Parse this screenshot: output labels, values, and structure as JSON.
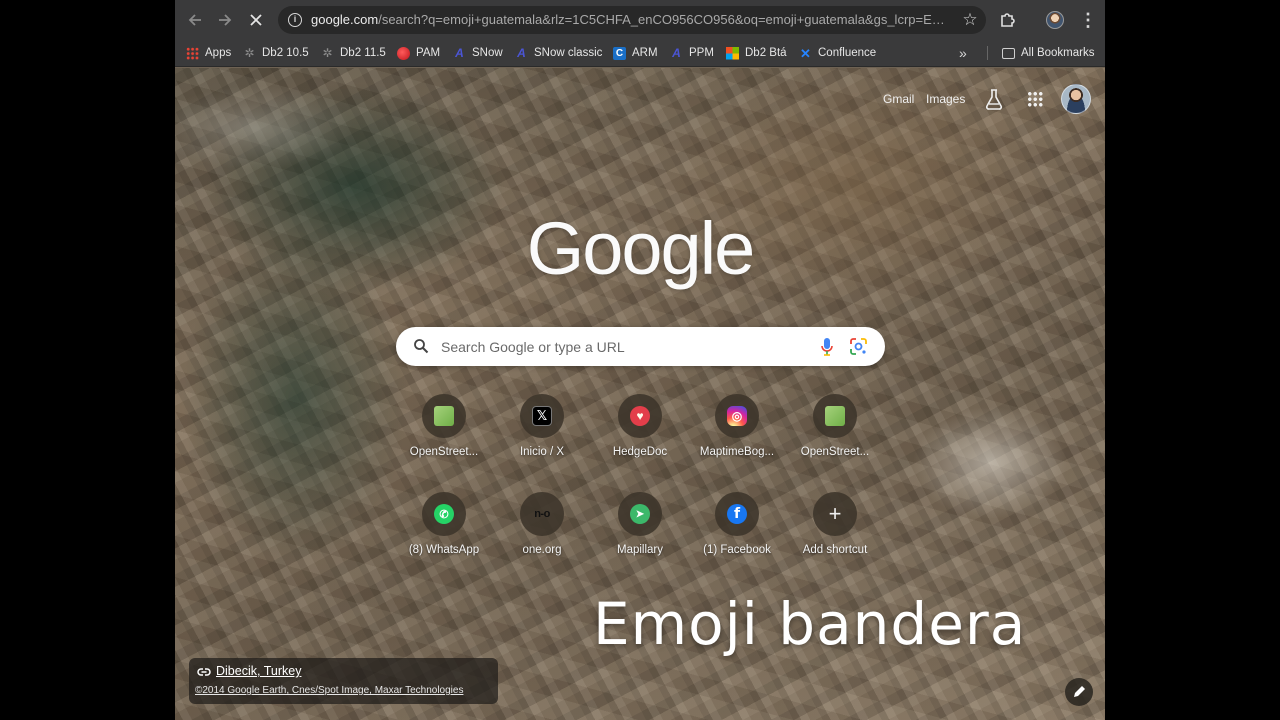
{
  "browser": {
    "url_host": "google.com",
    "url_rest": "/search?q=emoji+guatemala&rlz=1C5CHFA_enCO956CO956&oq=emoji+guatemala&gs_lcrp=EgZj...",
    "nav_icons": {
      "back": "arrow-left-icon",
      "forward": "arrow-right-icon",
      "stop": "close-icon"
    }
  },
  "bookmarks": {
    "items": [
      {
        "label": "Apps",
        "icon": "apps-grid-icon"
      },
      {
        "label": "Db2 10.5",
        "icon": "db2-icon"
      },
      {
        "label": "Db2 11.5",
        "icon": "db2-icon"
      },
      {
        "label": "PAM",
        "icon": "pam-icon"
      },
      {
        "label": "SNow",
        "icon": "servicenow-icon"
      },
      {
        "label": "SNow classic",
        "icon": "servicenow-icon"
      },
      {
        "label": "ARM",
        "icon": "arm-icon"
      },
      {
        "label": "PPM",
        "icon": "ppm-icon"
      },
      {
        "label": "Db2 Btá",
        "icon": "microsoft-icon"
      },
      {
        "label": "Confluence",
        "icon": "confluence-icon"
      }
    ],
    "all_bookmarks": "All Bookmarks"
  },
  "header": {
    "gmail": "Gmail",
    "images": "Images"
  },
  "logo": "Google",
  "search": {
    "placeholder": "Search Google or type a URL"
  },
  "shortcuts": [
    {
      "label": "OpenStreet...",
      "glyph": "",
      "icon": "openstreetmap-icon"
    },
    {
      "label": "Inicio / X",
      "glyph": "𝕏",
      "icon": "x-icon"
    },
    {
      "label": "HedgeDoc",
      "glyph": "♥",
      "icon": "hedgedoc-icon"
    },
    {
      "label": "MaptimeBog...",
      "glyph": "◎",
      "icon": "instagram-icon"
    },
    {
      "label": "OpenStreet...",
      "glyph": "",
      "icon": "openstreetmap-icon"
    },
    {
      "label": "(8) WhatsApp",
      "glyph": "✆",
      "icon": "whatsapp-icon"
    },
    {
      "label": "one.org",
      "glyph": "n-o",
      "icon": "one-org-icon"
    },
    {
      "label": "Mapillary",
      "glyph": "➤",
      "icon": "mapillary-icon"
    },
    {
      "label": "(1) Facebook",
      "glyph": "f",
      "icon": "facebook-icon"
    },
    {
      "label": "Add shortcut",
      "glyph": "+",
      "icon": "plus-icon"
    }
  ],
  "caption": "Emoji bandera",
  "attribution": {
    "place": "Dibecik, Turkey",
    "credit": "©2014 Google Earth, Cnes/Spot Image, Maxar Technologies"
  },
  "colors": {
    "toolbar": "#3a3a3b",
    "omnibox": "#282828",
    "search_box": "#ffffff"
  }
}
